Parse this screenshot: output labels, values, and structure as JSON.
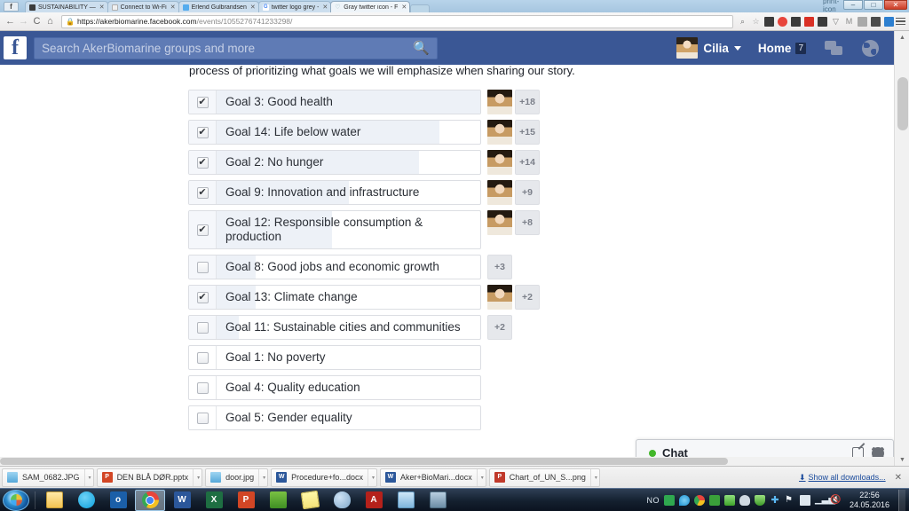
{
  "browser": {
    "tabs": [
      {
        "title": "SUSTAINABILITY —",
        "favicon": "page-icon",
        "active": false
      },
      {
        "title": "Connect to Wi-Fi",
        "favicon": "wifi-icon",
        "active": false
      },
      {
        "title": "Erlend Gulbrandsen",
        "favicon": "twitter-icon",
        "active": false
      },
      {
        "title": "twitter logo grey -",
        "favicon": "google-icon",
        "active": false
      },
      {
        "title": "Gray twitter icon - F",
        "favicon": "heart-icon",
        "active": true
      }
    ],
    "url_host": "https://akerbiomarine.facebook.com",
    "url_path": "/events/1055276741233298/",
    "lock_icon": "lock-icon",
    "nav": {
      "back": "←",
      "forward": "→",
      "reload": "C",
      "home": "⌂"
    },
    "window_controls": {
      "print": "print-icon",
      "minimize": "–",
      "maximize": "□",
      "close": "✕"
    },
    "menu_icon": "hamburger-menu-icon",
    "extension_icons": [
      {
        "name": "zoom-icon",
        "color": "#6e6e6e"
      },
      {
        "name": "bookmark-star-icon",
        "color": "#9a9a9a"
      },
      {
        "name": "pocket-icon",
        "color": "#3b3b3b"
      },
      {
        "name": "adblock-icon",
        "color": "#e8453c"
      },
      {
        "name": "evernote-clipper-icon",
        "color": "#3b3b3b"
      },
      {
        "name": "gmail-icon",
        "color": "#d93025"
      },
      {
        "name": "puzzle-extension-icon",
        "color": "#3b3b3b"
      },
      {
        "name": "filter-icon",
        "color": "#7a7a7a"
      },
      {
        "name": "mendeley-icon",
        "color": "#8a8a8a"
      },
      {
        "name": "grid-icon",
        "color": "#a9a9a9"
      },
      {
        "name": "elephant-icon",
        "color": "#4b4b4b"
      },
      {
        "name": "blue-extension-icon",
        "color": "#2d7fd0"
      }
    ]
  },
  "facebook": {
    "logo": "facebook-f-logo",
    "search": {
      "placeholder": "Search AkerBiomarine groups and more",
      "value": "",
      "icon": "search-icon"
    },
    "account_name": "Cilia",
    "home_label": "Home",
    "home_badge": "7",
    "messages_icon": "messages-icon",
    "globe_icon": "globe-notifications-icon",
    "intro_text": "process of prioritizing what goals we will emphasize when sharing our story.",
    "poll": [
      {
        "label": "Goal 3: Good health",
        "checked": true,
        "fill_pct": 100,
        "count": "+18",
        "has_avatar": true
      },
      {
        "label": "Goal 14: Life below water",
        "checked": true,
        "fill_pct": 86,
        "count": "+15",
        "has_avatar": true
      },
      {
        "label": "Goal 2: No hunger",
        "checked": true,
        "fill_pct": 79,
        "count": "+14",
        "has_avatar": true
      },
      {
        "label": "Goal 9: Innovation and infrastructure",
        "checked": true,
        "fill_pct": 55,
        "count": "+9",
        "has_avatar": true
      },
      {
        "label": "Goal 12: Responsible consumption & production",
        "checked": true,
        "fill_pct": 49,
        "count": "+8",
        "has_avatar": true
      },
      {
        "label": "Goal 8: Good jobs and economic growth",
        "checked": false,
        "fill_pct": 23,
        "count": "+3",
        "has_avatar": false
      },
      {
        "label": "Goal 13: Climate change",
        "checked": true,
        "fill_pct": 23,
        "count": "+2",
        "has_avatar": true
      },
      {
        "label": "Goal 11: Sustainable cities and communities",
        "checked": false,
        "fill_pct": 17,
        "count": "+2",
        "has_avatar": false
      },
      {
        "label": "Goal 1: No poverty",
        "checked": false,
        "fill_pct": 0,
        "count": "",
        "has_avatar": false
      },
      {
        "label": "Goal 4: Quality education",
        "checked": false,
        "fill_pct": 0,
        "count": "",
        "has_avatar": false
      },
      {
        "label": "Goal 5: Gender equality",
        "checked": false,
        "fill_pct": 0,
        "count": "",
        "has_avatar": false
      }
    ],
    "checkmark": "✔",
    "chat": {
      "label": "Chat",
      "status_color": "#42b72a",
      "compose_icon": "compose-icon",
      "settings_icon": "gear-icon"
    }
  },
  "downloads": {
    "items": [
      {
        "name": "SAM_0682.JPG",
        "type": "jpg",
        "badge": ""
      },
      {
        "name": "DEN BLÅ DØR.pptx",
        "type": "ppt",
        "badge": "P"
      },
      {
        "name": "door.jpg",
        "type": "jpg",
        "badge": ""
      },
      {
        "name": "Procedure+fo...docx",
        "type": "doc",
        "badge": "W"
      },
      {
        "name": "Aker+BioMari...docx",
        "type": "doc",
        "badge": "W"
      },
      {
        "name": "Chart_of_UN_S...png",
        "type": "png",
        "badge": "P"
      }
    ],
    "show_all_label": "Show all downloads...",
    "show_all_icon": "download-arrow-icon",
    "close_icon": "close-icon"
  },
  "taskbar": {
    "start_icon": "windows-start-orb",
    "pinned": [
      {
        "name": "explorer-icon",
        "label": ""
      },
      {
        "name": "skype-icon",
        "label": ""
      },
      {
        "name": "outlook-icon",
        "label": "o"
      },
      {
        "name": "chrome-icon",
        "label": "",
        "active": true
      },
      {
        "name": "word-icon",
        "label": "W"
      },
      {
        "name": "excel-icon",
        "label": "X"
      },
      {
        "name": "powerpoint-icon",
        "label": "P"
      },
      {
        "name": "evernote-icon",
        "label": ""
      },
      {
        "name": "sticky-notes-icon",
        "label": ""
      },
      {
        "name": "paint-icon",
        "label": ""
      },
      {
        "name": "adobe-reader-icon",
        "label": "A"
      },
      {
        "name": "photo-viewer-icon",
        "label": ""
      },
      {
        "name": "remote-desktop-icon",
        "label": ""
      }
    ],
    "tray": {
      "language": "NO",
      "icons": [
        {
          "name": "excel-tray-icon",
          "cls": "t-green"
        },
        {
          "name": "dropbox-tray-icon",
          "cls": "t-drop"
        },
        {
          "name": "chrome-tray-icon",
          "cls": "t-chrome"
        },
        {
          "name": "health-tray-icon",
          "cls": "t-plus"
        },
        {
          "name": "sync-tray-icon",
          "cls": "t-sync"
        },
        {
          "name": "onedrive-tray-icon",
          "cls": "t-cloud"
        },
        {
          "name": "antivirus-tray-icon",
          "cls": "t-shield"
        },
        {
          "name": "bluetooth-tray-icon",
          "cls": "t-bt",
          "glyph": "✚"
        },
        {
          "name": "action-center-flag-icon",
          "cls": "t-flag",
          "glyph": "⚑"
        },
        {
          "name": "battery-tray-icon",
          "cls": "t-batt"
        },
        {
          "name": "network-signal-icon",
          "cls": "t-bars",
          "glyph": "▁▃▅"
        },
        {
          "name": "volume-muted-icon",
          "cls": "t-vol",
          "glyph": "🔇"
        }
      ],
      "time": "22:56",
      "date": "24.05.2016"
    }
  }
}
